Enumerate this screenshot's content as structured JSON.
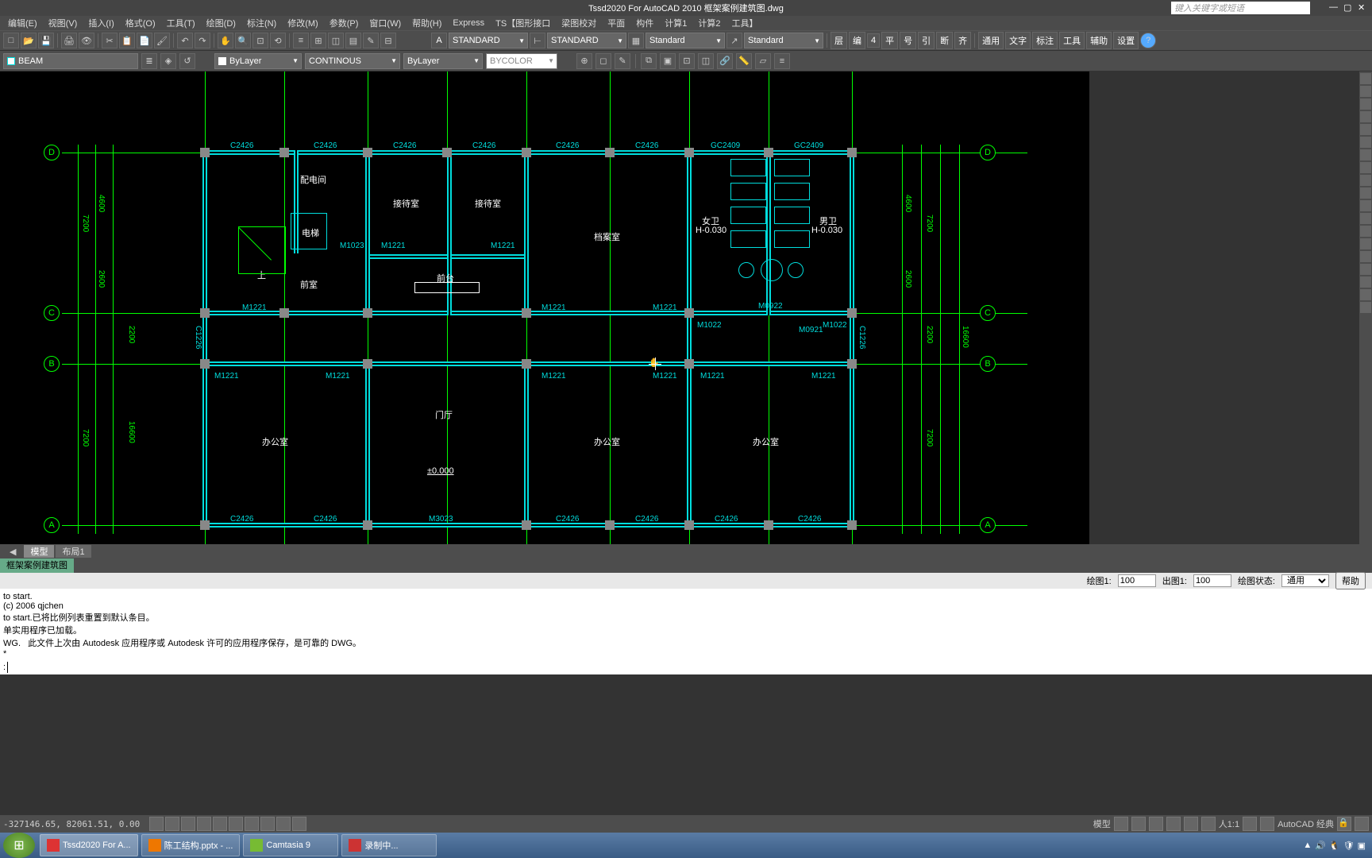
{
  "app": {
    "title": "Tssd2020 For AutoCAD 2010    框架案例建筑图.dwg",
    "search_placeholder": "键入关键字或短语"
  },
  "menu": [
    "编辑(E)",
    "视图(V)",
    "插入(I)",
    "格式(O)",
    "工具(T)",
    "绘图(D)",
    "标注(N)",
    "修改(M)",
    "参数(P)",
    "窗口(W)",
    "帮助(H)",
    "Express",
    "TS【图形接口",
    "梁图校对",
    "平面",
    "构件",
    "计算1",
    "计算2",
    "工具】"
  ],
  "style_dropdowns": {
    "text_style": "STANDARD",
    "dim_style": "STANDARD",
    "table_style": "Standard",
    "mleader_style": "Standard"
  },
  "text_buttons": [
    "层",
    "编",
    "4",
    "平",
    "号",
    "引",
    "断",
    "齐"
  ],
  "panel_buttons": [
    "通用",
    "文字",
    "标注",
    "工具",
    "辅助",
    "设置"
  ],
  "layer": {
    "current": "BEAM",
    "color": "ByLayer",
    "linetype": "CONTINOUS",
    "lineweight": "ByLayer",
    "plotstyle": "BYCOLOR"
  },
  "tabs": {
    "model": "模型",
    "layout": "布局1"
  },
  "file_tab": "框架案例建筑图",
  "status_row": {
    "scale1_label": "绘图1:",
    "scale1_val": "100",
    "scale2_label": "出图1:",
    "scale2_val": "100",
    "state_label": "绘图状态:",
    "state_val": "通用",
    "help": "帮助"
  },
  "cmd_lines": [
    "to start.",
    "(c) 2006 qjchen",
    "to start.已将比例列表重置到默认条目。",
    "单实用程序已加载。",
    "WG.   此文件上次由 Autodesk 应用程序或 Autodesk 许可的应用程序保存，是可靠的 DWG。",
    "*"
  ],
  "cmd_prompt": ":",
  "status_bar": {
    "coords": "-327146.65, 82061.51, 0.00",
    "right_label": "AutoCAD 经典"
  },
  "taskbar": {
    "items": [
      {
        "label": "Tssd2020 For A...",
        "active": true
      },
      {
        "label": "陈工结构.pptx - ...",
        "active": false
      },
      {
        "label": "Camtasia 9",
        "active": false
      },
      {
        "label": "录制中...",
        "active": false
      }
    ]
  },
  "drawing": {
    "grid_bubbles_v": [
      "A",
      "B",
      "C",
      "D"
    ],
    "columns_top": [
      "C2426",
      "C2426",
      "C2426",
      "C2426",
      "C2426",
      "C2426",
      "GC2409",
      "GC2409"
    ],
    "columns_bottom": [
      "C2426",
      "C2426",
      "M3023",
      "C2426",
      "C2426",
      "C2426",
      "C2426"
    ],
    "columns_side": [
      "C1226",
      "C1226"
    ],
    "rooms": {
      "peidian": "配电间",
      "jiedai": "接待室",
      "jiedai2": "接待室",
      "dangan": "档案室",
      "nvwei": "女卫",
      "nvwei_h": "H-0.030",
      "nanwei": "男卫",
      "nanwei_h": "H-0.030",
      "dianti": "电梯",
      "shang": "上",
      "qianshi": "前室",
      "qiantai": "前台",
      "menting": "门厅",
      "bangong1": "办公室",
      "bangong2": "办公室",
      "bangong3": "办公室",
      "elev": "±0.000"
    },
    "doors": {
      "m1023": "M1023",
      "m1221": "M1221",
      "m1022": "M1022",
      "m0921": "M0921",
      "m0922": "M0922"
    },
    "dims_v": {
      "d7200": "7200",
      "d16600": "16600",
      "d4600": "4600",
      "d2600": "2600",
      "d2200": "2200"
    }
  }
}
